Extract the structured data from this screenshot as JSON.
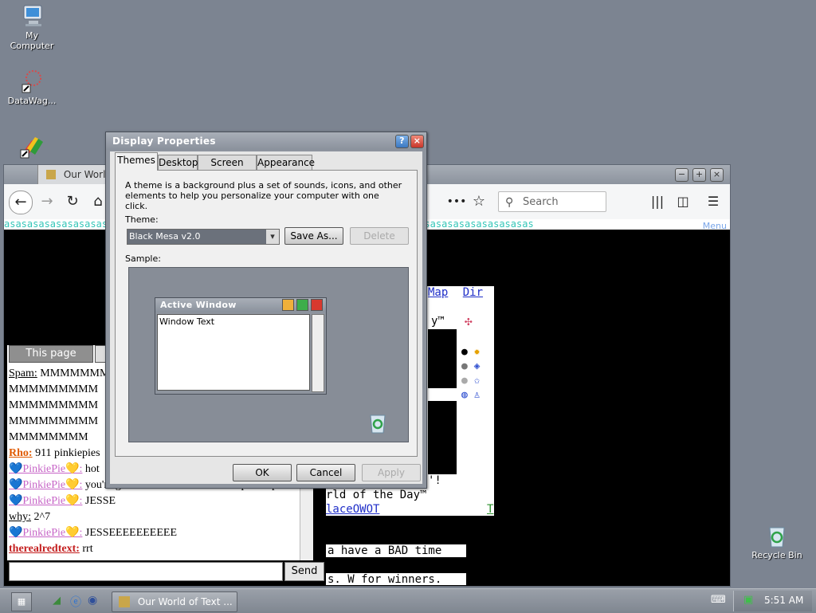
{
  "desktop": {
    "icons": [
      {
        "label": "My\nComputer",
        "name": "my-computer"
      },
      {
        "label": "DataWag...",
        "name": "datawag"
      },
      {
        "label": "",
        "name": "app-shortcut"
      }
    ],
    "recycle_bin": "Recycle Bin"
  },
  "browser": {
    "tab_title": "Our World",
    "search_placeholder": "Search",
    "marquee_text": "asasasasasasasasasasasasasasasasasasasasasasasasasasasasasasasasasasasasasasasasasasasasasas",
    "menu_hint": "Menu",
    "chat": {
      "tab_active": "This page",
      "messages": [
        {
          "name": "Spam:",
          "name_color": "#000000",
          "text": "MMMMMMM"
        },
        {
          "name": "",
          "name_color": "#000000",
          "text": "MMMMMMMMM"
        },
        {
          "name": "",
          "name_color": "#000000",
          "text": "MMMMMMMMM"
        },
        {
          "name": "",
          "name_color": "#000000",
          "text": "MMMMMMMMM"
        },
        {
          "name": "",
          "name_color": "#000000",
          "text": "MMMMMMMM"
        },
        {
          "name": "Rho:",
          "name_color": "#e05a00",
          "text": "911 pinkiepies"
        },
        {
          "name": "💙PinkiePie💛:",
          "name_color": "#c765c7",
          "text": "hot"
        },
        {
          "name": "💙PinkiePie💛:",
          "name_color": "#c765c7",
          "text": "you're gonna have a GOOD time - pinkie pie"
        },
        {
          "name": "💙PinkiePie💛:",
          "name_color": "#c765c7",
          "text": "JESSE"
        },
        {
          "name": "why:",
          "name_color": "#000000",
          "text": "2^7"
        },
        {
          "name": "💙PinkiePie💛:",
          "name_color": "#c765c7",
          "text": "JESSEEEEEEEEEE"
        },
        {
          "name": "therealredtext:",
          "name_color": "#c41e1e",
          "text": "rrt"
        }
      ],
      "send_label": "Send"
    },
    "content": {
      "links": [
        "Map",
        "Dir"
      ],
      "superscript_line": "y™",
      "line_exclaim": "'!",
      "world_of_day": "rld of the Day™",
      "place_link": "laceOWOT",
      "t_link": "T",
      "bad_time": "a have a BAD time",
      "winners": "s. W for winners."
    }
  },
  "dialog": {
    "title": "Display Properties",
    "tabs": [
      "Themes",
      "Desktop",
      "Screen Saver",
      "Appearance"
    ],
    "description": "A theme is a background plus a set of sounds, icons, and other elements to help you personalize your computer with one click.",
    "theme_label": "Theme:",
    "theme_value": "Black Mesa v2.0",
    "save_as": "Save As...",
    "delete": "Delete",
    "sample_label": "Sample:",
    "sample_window_title": "Active Window",
    "sample_window_text": "Window Text",
    "ok": "OK",
    "cancel": "Cancel",
    "apply": "Apply"
  },
  "taskbar": {
    "task_label": "Our World of Text ...",
    "clock": "5:51 AM"
  }
}
